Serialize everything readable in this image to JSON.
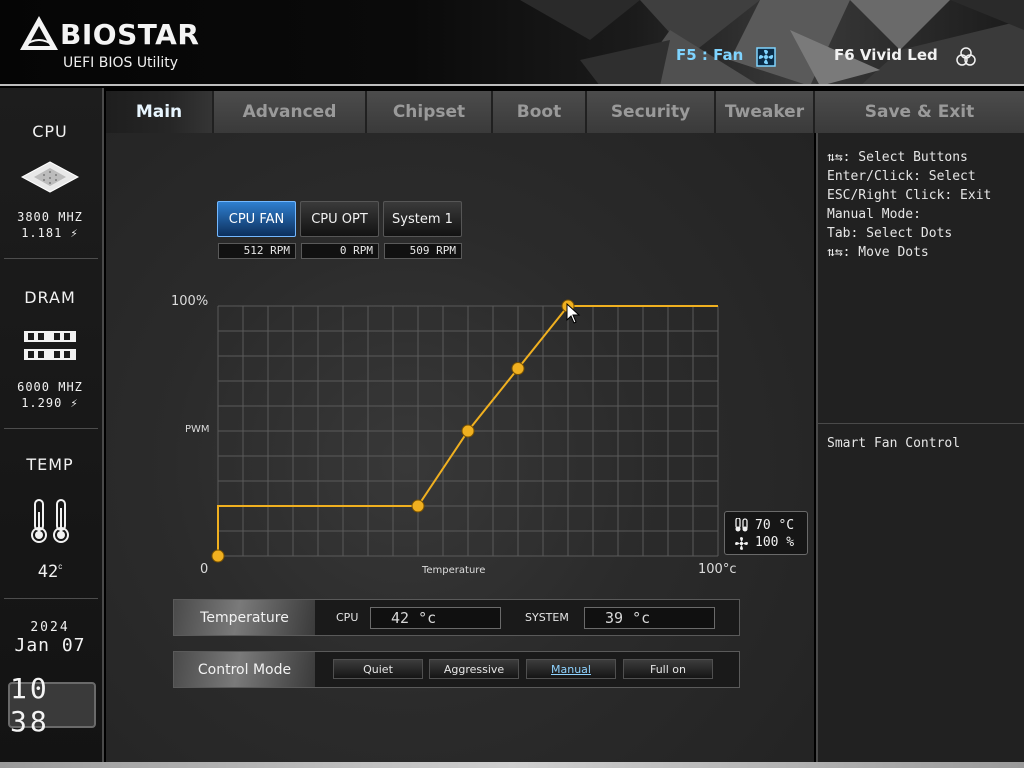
{
  "header": {
    "logo_text": "BIOSTAR",
    "logo_sub": "UEFI BIOS Utility",
    "hotkey_fan": "F5 : Fan",
    "hotkey_led": "F6  Vivid Led"
  },
  "sidebar": {
    "cpu": {
      "title": "CPU",
      "freq": "3800 MHZ",
      "volt": "1.181 ⚡"
    },
    "dram": {
      "title": "DRAM",
      "freq": "6000 MHZ",
      "volt": "1.290 ⚡"
    },
    "temp": {
      "title": "TEMP",
      "value": "42",
      "unit": "c"
    },
    "date": {
      "year": "2024",
      "month_day": "Jan 07"
    },
    "clock": "10 38"
  },
  "tabs": [
    {
      "label": "Main"
    },
    {
      "label": "Advanced"
    },
    {
      "label": "Chipset"
    },
    {
      "label": "Boot"
    },
    {
      "label": "Security"
    },
    {
      "label": "Tweaker"
    },
    {
      "label": "Save & Exit"
    }
  ],
  "fans": [
    {
      "label": "CPU FAN",
      "rpm": "512 RPM",
      "active": true
    },
    {
      "label": "CPU OPT",
      "rpm": "0 RPM",
      "active": false
    },
    {
      "label": "System 1",
      "rpm": "509 RPM",
      "active": false
    }
  ],
  "graph": {
    "y_max_label": "100%",
    "y_label": "PWM",
    "x_min_label": "0",
    "x_label": "Temperature",
    "x_max_label": "100°c",
    "points": [
      {
        "temp": 0,
        "pwm": 0
      },
      {
        "temp": 40,
        "pwm": 20
      },
      {
        "temp": 50,
        "pwm": 50
      },
      {
        "temp": 60,
        "pwm": 75
      },
      {
        "temp": 70,
        "pwm": 100
      }
    ],
    "badge_temp": "70 °C",
    "badge_pwm": "100 %",
    "line_color": "#f0b020"
  },
  "temperature_row": {
    "label": "Temperature",
    "cpu_label": "CPU",
    "cpu_value": "42 °c",
    "system_label": "SYSTEM",
    "system_value": "39 °c"
  },
  "control_mode": {
    "label": "Control Mode",
    "modes": [
      "Quiet",
      "Aggressive",
      "Manual",
      "Full on"
    ],
    "selected": "Manual"
  },
  "help": [
    "⇅⇆: Select Buttons",
    "Enter/Click: Select",
    "ESC/Right Click: Exit",
    "Manual Mode:",
    "Tab: Select Dots",
    "⇅⇆: Move Dots"
  ],
  "description": "Smart Fan Control"
}
